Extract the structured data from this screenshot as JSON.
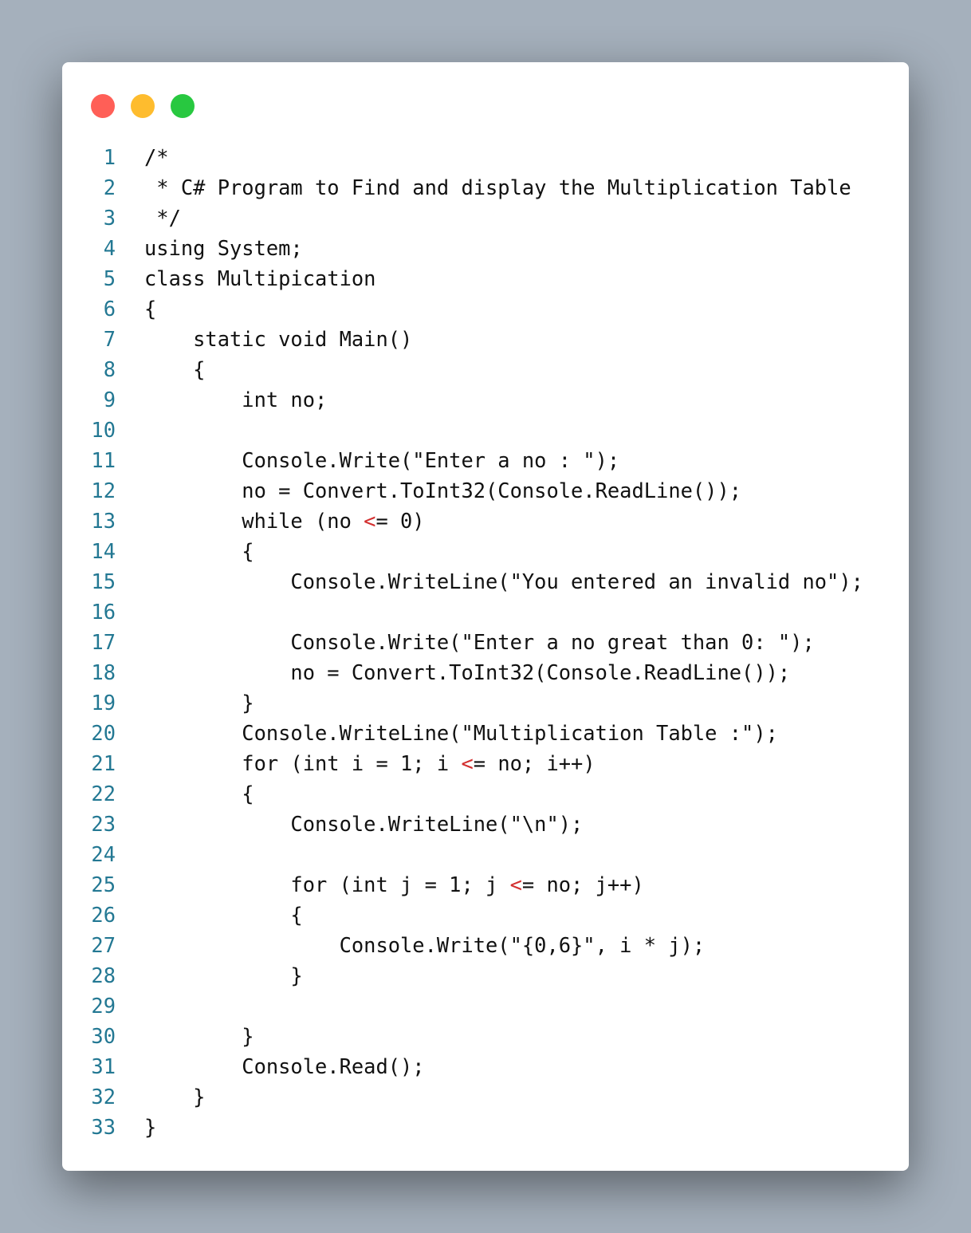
{
  "window_controls": {
    "close_color": "#ff5f57",
    "minimize_color": "#febc2e",
    "maximize_color": "#28c840"
  },
  "colors": {
    "line_number": "#237893",
    "text": "#111111",
    "operator": "#d32f2f"
  },
  "code_lines": [
    "/*",
    " * C# Program to Find and display the Multiplication Table",
    " */",
    "using System;",
    "class Multipication",
    "{",
    "    static void Main()",
    "    {",
    "        int no;",
    "",
    "        Console.Write(\"Enter a no : \");",
    "        no = Convert.ToInt32(Console.ReadLine());",
    "        while (no <= 0)",
    "        {",
    "            Console.WriteLine(\"You entered an invalid no\");",
    "",
    "            Console.Write(\"Enter a no great than 0: \");",
    "            no = Convert.ToInt32(Console.ReadLine());",
    "        }",
    "        Console.WriteLine(\"Multiplication Table :\");",
    "        for (int i = 1; i <= no; i++)",
    "        {",
    "            Console.WriteLine(\"\\n\");",
    "",
    "            for (int j = 1; j <= no; j++)",
    "            {",
    "                Console.Write(\"{0,6}\", i * j);",
    "            }",
    "",
    "        }",
    "        Console.Read();",
    "    }",
    "}"
  ]
}
